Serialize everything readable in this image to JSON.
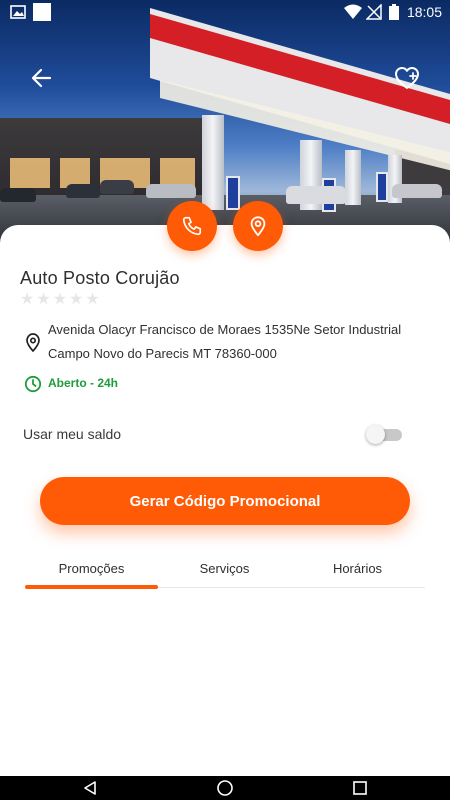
{
  "status_bar": {
    "time": "18:05"
  },
  "station": {
    "name": "Auto Posto Corujão",
    "rating_stars": 0,
    "rating_max": 5,
    "address_line1": "Avenida Olacyr Francisco de Moraes 1535Ne Setor Industrial",
    "address_line2": "Campo Novo do Parecis MT 78360-000",
    "open_status": "Aberto - 24h"
  },
  "balance": {
    "label": "Usar meu saldo",
    "enabled": false
  },
  "cta": {
    "label": "Gerar Código Promocional"
  },
  "tabs": [
    {
      "label": "Promoções",
      "active": true
    },
    {
      "label": "Serviços",
      "active": false
    },
    {
      "label": "Horários",
      "active": false
    }
  ],
  "icons": {
    "back": "arrow-left-icon",
    "favorite": "heart-plus-icon",
    "call": "phone-icon",
    "location": "map-pin-icon",
    "address": "map-pin-icon",
    "hours": "clock-icon"
  },
  "colors": {
    "accent": "#ff5a06",
    "open": "#1e9c3a",
    "text": "#2f2f2f"
  }
}
